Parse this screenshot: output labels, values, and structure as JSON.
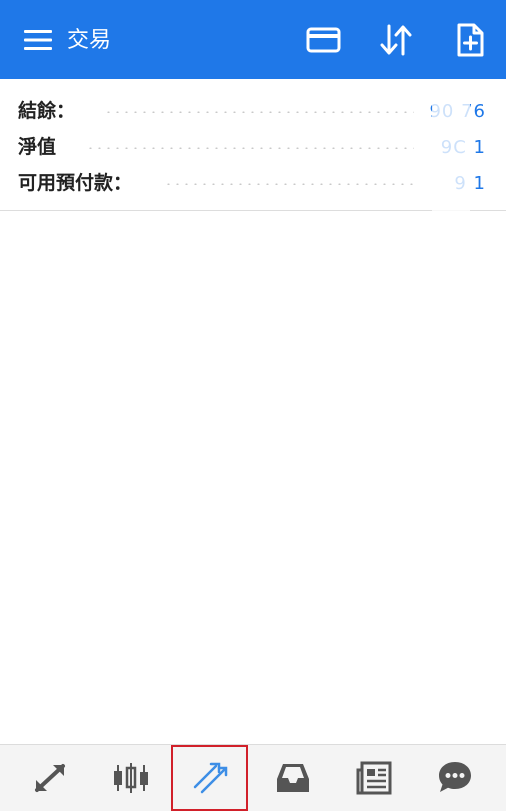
{
  "header": {
    "title": "交易",
    "icons": [
      "hamburger-icon",
      "card-icon",
      "sort-icon",
      "new-document-icon"
    ],
    "accent": "#1f78e8"
  },
  "summary": {
    "rows": [
      {
        "label": "結餘：",
        "value": "90 76"
      },
      {
        "label": "淨值",
        "value": "9C 1"
      },
      {
        "label": "可用預付款：",
        "value": "9 1"
      }
    ]
  },
  "bottom_nav": {
    "items": [
      {
        "icon": "trade-arrows-icon",
        "active": false
      },
      {
        "icon": "candlestick-icon",
        "active": false
      },
      {
        "icon": "trending-icon",
        "active": true
      },
      {
        "icon": "inbox-icon",
        "active": false
      },
      {
        "icon": "news-icon",
        "active": false
      },
      {
        "icon": "chat-icon",
        "active": false
      }
    ],
    "active_color": "#3d8ee6",
    "icon_color": "#555555"
  }
}
